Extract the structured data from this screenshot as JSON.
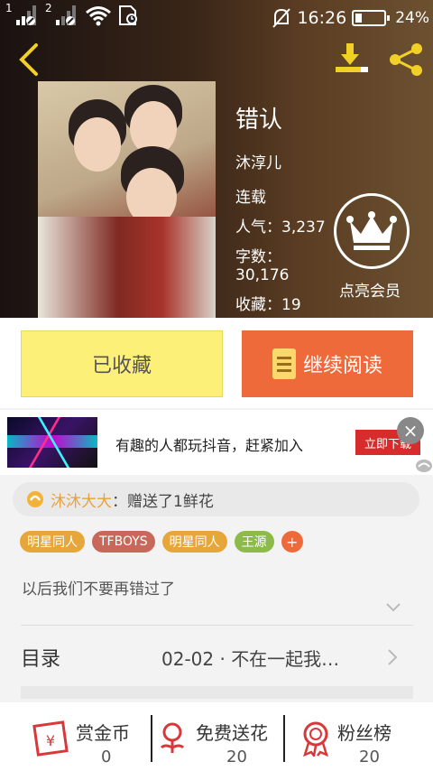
{
  "status_bar": {
    "sim1": "1",
    "sim2": "2",
    "time": "16:26",
    "battery": "24%",
    "battery_level": 0.24
  },
  "book": {
    "title": "错认",
    "author": "沐淳儿",
    "status": "连载",
    "popularity": "人气：3,237",
    "word_count_label": "字数：",
    "word_count": "30,176",
    "favorites": "收藏：19"
  },
  "vip": {
    "label": "点亮会员"
  },
  "actions": {
    "favorited": "已收藏",
    "continue": "继续阅读"
  },
  "ad": {
    "text": "有趣的人都玩抖音，赶紧加入",
    "button": "立即下载",
    "close": "×"
  },
  "gift": {
    "user": "沐沐大大",
    "message": "：赠送了1鲜花"
  },
  "tags": [
    {
      "label": "明星同人",
      "color": "#e6a63a"
    },
    {
      "label": "TFBOYS",
      "color": "#c8685a"
    },
    {
      "label": "明星同人",
      "color": "#e6a63a"
    },
    {
      "label": "王源",
      "color": "#8dbb4a"
    }
  ],
  "tag_add": "+",
  "description": "以后我们不要再错过了",
  "toc": {
    "label": "目录",
    "latest": "02-02 · 不在一起我…"
  },
  "stats": [
    {
      "label": "赏金币",
      "value": "0",
      "icon": "red-envelope-icon"
    },
    {
      "label": "免费送花",
      "value": "20",
      "icon": "flower-icon"
    },
    {
      "label": "粉丝榜",
      "value": "20",
      "icon": "medal-icon"
    }
  ],
  "colors": {
    "accent_yellow": "#f1d028",
    "orange": "#ef6a3a",
    "favorite_yellow": "#fdf079"
  }
}
